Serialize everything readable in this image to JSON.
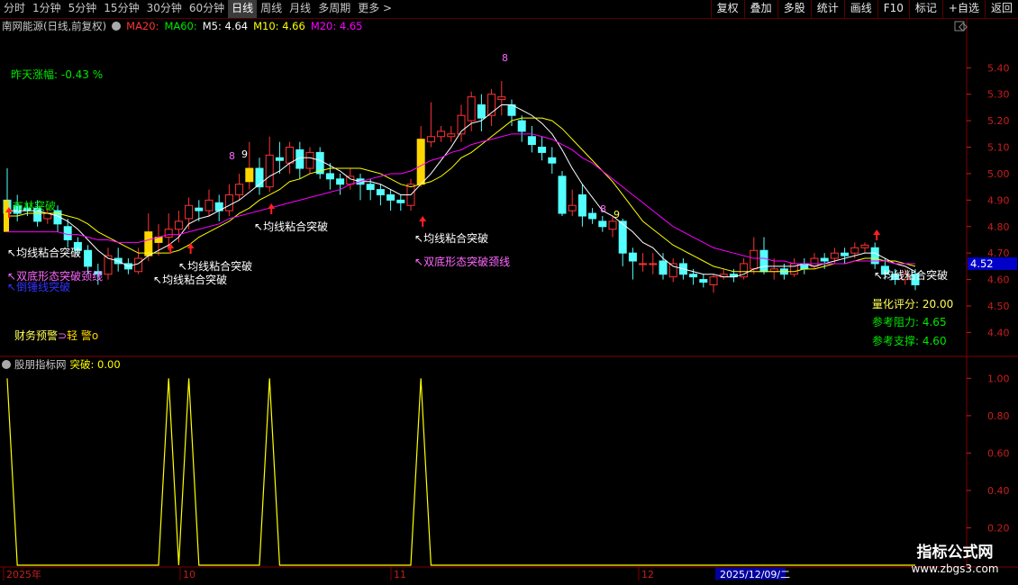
{
  "toolbar": {
    "tabs": [
      {
        "label": "分时",
        "active": false
      },
      {
        "label": "1分钟",
        "active": false
      },
      {
        "label": "5分钟",
        "active": false
      },
      {
        "label": "15分钟",
        "active": false
      },
      {
        "label": "30分钟",
        "active": false
      },
      {
        "label": "60分钟",
        "active": false
      },
      {
        "label": "日线",
        "active": true
      },
      {
        "label": "周线",
        "active": false
      },
      {
        "label": "月线",
        "active": false
      },
      {
        "label": "多周期",
        "active": false
      },
      {
        "label": "更多 >",
        "active": false
      }
    ],
    "right": [
      "复权",
      "叠加",
      "多股",
      "统计",
      "画线",
      "F10",
      "标记",
      "+自选",
      "返回"
    ]
  },
  "main_header": {
    "title": "南网能源(日线,前复权)",
    "ma20": "MA20:",
    "ma60": "MA60:",
    "m5": "M5: 4.64",
    "m10": "M10: 4.66",
    "m20": "M20: 4.65"
  },
  "labels": {
    "prev_change": "昨天涨幅: -0.43 %",
    "score": "量化评分: 20.00",
    "resistance": "参考阻力: 4.65",
    "support": "参考支撑: 4.60",
    "warning": "财务预警",
    "warning_level": "轻 警",
    "sub_title": "股朋指标网",
    "sub_value": "突破: 0.00",
    "last_price": "4.52"
  },
  "annotations": {
    "ma_break": "均线粘合突破",
    "double_bottom": "双底形态突破颈线",
    "reversal": "倒锤线突破",
    "fast_break": "布林突破"
  },
  "colors": {
    "up": "#ff3232",
    "down": "#54ffff",
    "ma5": "#ffffff",
    "ma10": "#ffff00",
    "ma20": "#ff00ff",
    "grid": "#800000",
    "axis_text": "#c81e1e",
    "label_green": "#00e600",
    "label_yellow": "#ffff55",
    "highlight": "#ffd700"
  },
  "watermark": {
    "title": "指标公式网",
    "url": "www.zbgs3.com"
  },
  "chart_data": [
    {
      "type": "candlestick",
      "title": "南网能源(日线,前复权)",
      "y_ticks": [
        "5.40",
        "5.30",
        "5.20",
        "5.10",
        "5.00",
        "4.90",
        "4.80",
        "4.70",
        "4.60",
        "4.50",
        "4.40"
      ],
      "ylim": [
        4.33,
        5.52
      ],
      "x_labels": [
        "2025年",
        "10",
        "11",
        "12",
        "2025/12/09/二"
      ],
      "candles": [
        [
          4.9,
          4.85,
          5.02,
          4.78
        ],
        [
          4.88,
          4.85,
          4.92,
          4.82
        ],
        [
          4.87,
          4.86,
          4.89,
          4.84
        ],
        [
          4.87,
          4.82,
          4.9,
          4.8
        ],
        [
          4.83,
          4.85,
          4.87,
          4.81
        ],
        [
          4.86,
          4.81,
          4.88,
          4.78
        ],
        [
          4.8,
          4.75,
          4.83,
          4.72
        ],
        [
          4.74,
          4.71,
          4.76,
          4.69
        ],
        [
          4.71,
          4.65,
          4.73,
          4.62
        ],
        [
          4.63,
          4.62,
          4.66,
          4.58
        ],
        [
          4.62,
          4.69,
          4.72,
          4.6
        ],
        [
          4.68,
          4.66,
          4.72,
          4.63
        ],
        [
          4.66,
          4.64,
          4.68,
          4.62
        ],
        [
          4.63,
          4.68,
          4.72,
          4.62
        ],
        [
          4.69,
          4.78,
          4.85,
          4.67
        ],
        [
          4.74,
          4.76,
          4.81,
          4.69
        ],
        [
          4.76,
          4.79,
          4.85,
          4.71
        ],
        [
          4.79,
          4.82,
          4.86,
          4.74
        ],
        [
          4.83,
          4.88,
          4.91,
          4.79
        ],
        [
          4.87,
          4.86,
          4.9,
          4.82
        ],
        [
          4.86,
          4.9,
          4.94,
          4.84
        ],
        [
          4.89,
          4.86,
          4.92,
          4.82
        ],
        [
          4.86,
          4.92,
          4.96,
          4.84
        ],
        [
          4.92,
          4.96,
          5.0,
          4.9
        ],
        [
          4.97,
          5.02,
          5.12,
          4.94
        ],
        [
          5.02,
          4.95,
          5.06,
          4.92
        ],
        [
          4.95,
          5.07,
          5.14,
          4.93
        ],
        [
          5.06,
          5.05,
          5.12,
          5.0
        ],
        [
          5.04,
          5.1,
          5.12,
          5.0
        ],
        [
          5.09,
          5.02,
          5.12,
          4.98
        ],
        [
          5.02,
          5.08,
          5.1,
          5.0
        ],
        [
          5.08,
          5.0,
          5.1,
          4.98
        ],
        [
          5.0,
          4.98,
          5.04,
          4.94
        ],
        [
          4.98,
          4.96,
          5.0,
          4.92
        ],
        [
          4.96,
          4.99,
          5.02,
          4.94
        ],
        [
          4.98,
          4.96,
          5.0,
          4.9
        ],
        [
          4.96,
          4.94,
          4.98,
          4.9
        ],
        [
          4.94,
          4.92,
          4.96,
          4.88
        ],
        [
          4.92,
          4.9,
          4.94,
          4.86
        ],
        [
          4.9,
          4.89,
          4.92,
          4.86
        ],
        [
          4.88,
          4.96,
          4.98,
          4.86
        ],
        [
          4.96,
          5.13,
          5.18,
          4.95
        ],
        [
          5.12,
          5.14,
          5.27,
          5.1
        ],
        [
          5.14,
          5.16,
          5.18,
          5.12
        ],
        [
          5.14,
          5.15,
          5.18,
          5.12
        ],
        [
          5.15,
          5.22,
          5.26,
          5.12
        ],
        [
          5.2,
          5.29,
          5.31,
          5.16
        ],
        [
          5.26,
          5.21,
          5.3,
          5.16
        ],
        [
          5.22,
          5.3,
          5.32,
          5.18
        ],
        [
          5.28,
          5.29,
          5.35,
          5.22
        ],
        [
          5.26,
          5.22,
          5.28,
          5.18
        ],
        [
          5.2,
          5.16,
          5.22,
          5.12
        ],
        [
          5.14,
          5.11,
          5.18,
          5.08
        ],
        [
          5.1,
          5.08,
          5.14,
          5.05
        ],
        [
          5.06,
          5.04,
          5.1,
          5.0
        ],
        [
          4.99,
          4.85,
          5.01,
          4.84
        ],
        [
          4.86,
          4.88,
          4.94,
          4.84
        ],
        [
          4.92,
          4.84,
          4.96,
          4.8
        ],
        [
          4.85,
          4.83,
          4.87,
          4.81
        ],
        [
          4.82,
          4.8,
          4.84,
          4.78
        ],
        [
          4.79,
          4.82,
          4.84,
          4.76
        ],
        [
          4.82,
          4.7,
          4.83,
          4.65
        ],
        [
          4.7,
          4.67,
          4.72,
          4.6
        ],
        [
          4.66,
          4.66,
          4.7,
          4.63
        ],
        [
          4.66,
          4.66,
          4.7,
          4.62
        ],
        [
          4.67,
          4.62,
          4.7,
          4.6
        ],
        [
          4.61,
          4.66,
          4.68,
          4.59
        ],
        [
          4.66,
          4.62,
          4.68,
          4.6
        ],
        [
          4.62,
          4.61,
          4.64,
          4.58
        ],
        [
          4.6,
          4.59,
          4.62,
          4.57
        ],
        [
          4.58,
          4.61,
          4.62,
          4.55
        ],
        [
          4.61,
          4.62,
          4.64,
          4.6
        ],
        [
          4.62,
          4.61,
          4.64,
          4.59
        ],
        [
          4.61,
          4.66,
          4.68,
          4.6
        ],
        [
          4.64,
          4.71,
          4.76,
          4.62
        ],
        [
          4.71,
          4.63,
          4.76,
          4.62
        ],
        [
          4.63,
          4.64,
          4.68,
          4.6
        ],
        [
          4.64,
          4.62,
          4.66,
          4.6
        ],
        [
          4.62,
          4.66,
          4.68,
          4.61
        ],
        [
          4.66,
          4.64,
          4.68,
          4.62
        ],
        [
          4.65,
          4.68,
          4.7,
          4.64
        ],
        [
          4.68,
          4.67,
          4.7,
          4.64
        ],
        [
          4.68,
          4.7,
          4.72,
          4.66
        ],
        [
          4.7,
          4.69,
          4.72,
          4.66
        ],
        [
          4.7,
          4.72,
          4.74,
          4.68
        ],
        [
          4.72,
          4.73,
          4.74,
          4.7
        ],
        [
          4.72,
          4.66,
          4.74,
          4.64
        ],
        [
          4.65,
          4.62,
          4.68,
          4.6
        ],
        [
          4.62,
          4.6,
          4.64,
          4.58
        ],
        [
          4.6,
          4.62,
          4.64,
          4.58
        ],
        [
          4.62,
          4.58,
          4.64,
          4.56
        ]
      ],
      "series": [
        {
          "name": "M5",
          "values": [
            4.86,
            4.86,
            4.86,
            4.86,
            4.85,
            4.84,
            4.82,
            4.79,
            4.75,
            4.71,
            4.68,
            4.67,
            4.65,
            4.66,
            4.69,
            4.71,
            4.73,
            4.76,
            4.81,
            4.83,
            4.84,
            4.86,
            4.88,
            4.9,
            4.93,
            4.96,
            4.99,
            5.01,
            5.04,
            5.06,
            5.06,
            5.05,
            5.03,
            5.01,
            4.98,
            4.97,
            4.97,
            4.96,
            4.94,
            4.92,
            4.92,
            4.96,
            5.0,
            5.05,
            5.1,
            5.16,
            5.19,
            5.2,
            5.23,
            5.26,
            5.26,
            5.24,
            5.22,
            5.19,
            5.15,
            5.09,
            5.02,
            4.96,
            4.91,
            4.86,
            4.84,
            4.81,
            4.78,
            4.74,
            4.72,
            4.68,
            4.65,
            4.64,
            4.63,
            4.62,
            4.62,
            4.61,
            4.61,
            4.62,
            4.64,
            4.65,
            4.65,
            4.65,
            4.65,
            4.66,
            4.65,
            4.66,
            4.67,
            4.68,
            4.69,
            4.7,
            4.7,
            4.68,
            4.66,
            4.65,
            4.63
          ]
        },
        {
          "name": "M10",
          "values": [
            4.84,
            4.84,
            4.85,
            4.85,
            4.85,
            4.85,
            4.84,
            4.83,
            4.81,
            4.78,
            4.76,
            4.74,
            4.72,
            4.7,
            4.7,
            4.7,
            4.7,
            4.71,
            4.73,
            4.76,
            4.78,
            4.8,
            4.82,
            4.85,
            4.87,
            4.9,
            4.92,
            4.94,
            4.97,
            4.98,
            5.0,
            5.01,
            5.02,
            5.02,
            5.02,
            5.02,
            5.01,
            5.0,
            4.98,
            4.96,
            4.95,
            4.96,
            4.97,
            4.99,
            5.02,
            5.06,
            5.08,
            5.11,
            5.14,
            5.17,
            5.2,
            5.21,
            5.21,
            5.21,
            5.2,
            5.17,
            5.13,
            5.09,
            5.05,
            5.01,
            4.97,
            4.92,
            4.87,
            4.82,
            4.79,
            4.76,
            4.73,
            4.71,
            4.69,
            4.67,
            4.65,
            4.64,
            4.63,
            4.63,
            4.63,
            4.63,
            4.63,
            4.63,
            4.63,
            4.64,
            4.64,
            4.65,
            4.66,
            4.66,
            4.67,
            4.68,
            4.68,
            4.67,
            4.67,
            4.66,
            4.65
          ]
        },
        {
          "name": "M20",
          "values": [
            4.78,
            4.78,
            4.78,
            4.78,
            4.78,
            4.78,
            4.77,
            4.77,
            4.76,
            4.75,
            4.75,
            4.74,
            4.74,
            4.74,
            4.75,
            4.76,
            4.77,
            4.77,
            4.78,
            4.79,
            4.8,
            4.81,
            4.83,
            4.84,
            4.85,
            4.86,
            4.87,
            4.88,
            4.89,
            4.9,
            4.91,
            4.92,
            4.93,
            4.94,
            4.96,
            4.97,
            4.98,
            4.99,
            5.0,
            5.0,
            5.01,
            5.03,
            5.05,
            5.06,
            5.08,
            5.09,
            5.11,
            5.12,
            5.13,
            5.14,
            5.15,
            5.15,
            5.15,
            5.14,
            5.13,
            5.11,
            5.09,
            5.06,
            5.04,
            5.01,
            4.98,
            4.95,
            4.92,
            4.89,
            4.86,
            4.83,
            4.8,
            4.78,
            4.76,
            4.74,
            4.72,
            4.71,
            4.7,
            4.69,
            4.68,
            4.68,
            4.67,
            4.67,
            4.66,
            4.66,
            4.66,
            4.66,
            4.66,
            4.66,
            4.67,
            4.67,
            4.67,
            4.67,
            4.66,
            4.66,
            4.66
          ]
        }
      ]
    },
    {
      "type": "line",
      "title": "股朋指标网",
      "y_ticks": [
        "1.00",
        "0.80",
        "0.60",
        "0.40",
        "0.20"
      ],
      "ylim": [
        0,
        1.05
      ],
      "series": [
        {
          "name": "突破",
          "values": [
            1,
            0,
            0,
            0,
            0,
            0,
            0,
            0,
            0,
            0,
            0,
            0,
            0,
            0,
            0,
            0,
            1,
            0,
            1,
            0,
            0,
            0,
            0,
            0,
            0,
            0,
            1,
            0,
            0,
            0,
            0,
            0,
            0,
            0,
            0,
            0,
            0,
            0,
            0,
            0,
            0,
            1,
            0,
            0,
            0,
            0,
            0,
            0,
            0,
            0,
            0,
            0,
            0,
            0,
            0,
            0,
            0,
            0,
            0,
            0,
            0,
            0,
            0,
            0,
            0,
            0,
            0,
            0,
            0,
            0,
            0,
            0,
            0,
            0,
            0,
            0,
            0,
            0,
            0,
            0,
            0,
            0,
            0,
            0,
            0,
            0,
            0,
            0,
            0,
            0,
            0
          ]
        }
      ]
    }
  ]
}
